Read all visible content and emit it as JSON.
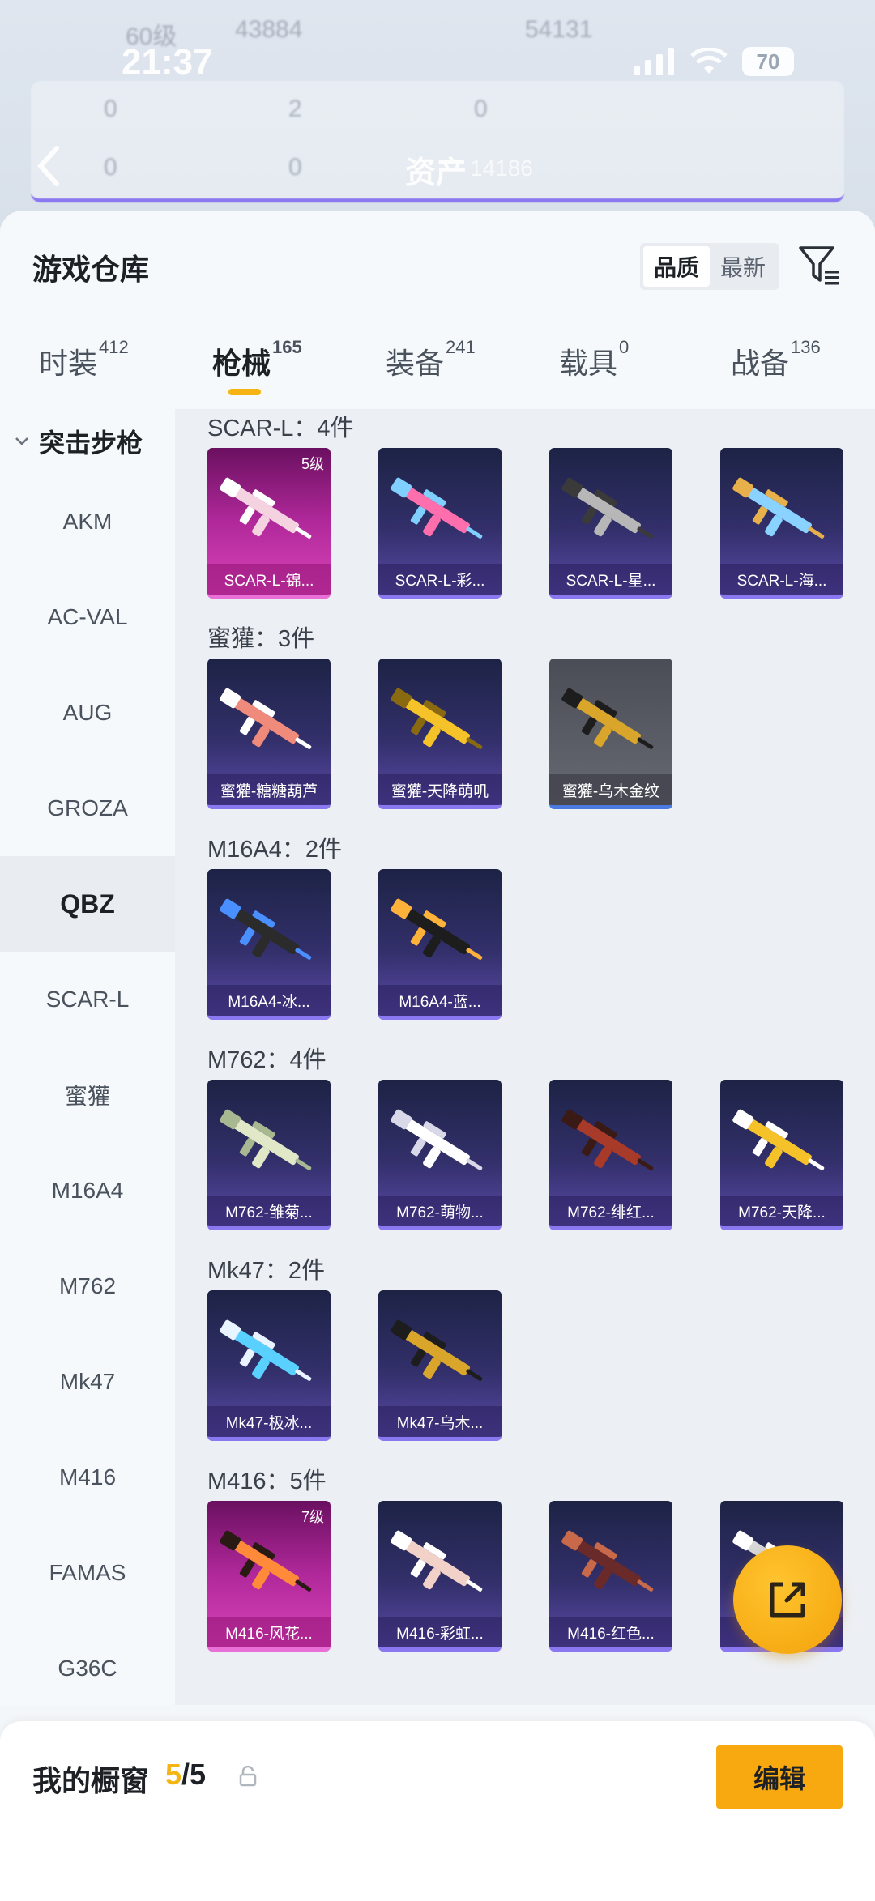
{
  "status_bar": {
    "time": "21:37",
    "battery": "70"
  },
  "background_header": {
    "level_text": "60级",
    "coins_left": "43884",
    "coins_right": "54131",
    "assets_label": "资产",
    "assets_value": "14186",
    "stat_values": [
      "0",
      "2",
      "0",
      "0",
      "0"
    ]
  },
  "warehouse": {
    "title": "游戏仓库",
    "sort_options": [
      "品质",
      "最新"
    ],
    "active_sort": "品质"
  },
  "tabs": [
    {
      "label": "时装",
      "count": "412"
    },
    {
      "label": "枪械",
      "count": "165",
      "active": true
    },
    {
      "label": "装备",
      "count": "241"
    },
    {
      "label": "载具",
      "count": "0"
    },
    {
      "label": "战备",
      "count": "136"
    }
  ],
  "categories": {
    "group": "突击步枪",
    "items": [
      "AKM",
      "AC-VAL",
      "AUG",
      "GROZA",
      "QBZ",
      "SCAR-L",
      "蜜獾",
      "M16A4",
      "M762",
      "Mk47",
      "M416",
      "FAMAS",
      "G36C"
    ],
    "active": "QBZ"
  },
  "sections": [
    {
      "title": "SCAR-L：4件",
      "items": [
        {
          "name": "SCAR-L-锦...",
          "level": "5级",
          "style": "pink"
        },
        {
          "name": "SCAR-L-彩..."
        },
        {
          "name": "SCAR-L-星..."
        },
        {
          "name": "SCAR-L-海..."
        }
      ]
    },
    {
      "title": "蜜獾：3件",
      "items": [
        {
          "name": "蜜獾-糖糖葫芦"
        },
        {
          "name": "蜜獾-天降萌叽"
        },
        {
          "name": "蜜獾-乌木金纹",
          "style": "gray"
        }
      ]
    },
    {
      "title": "M16A4：2件",
      "items": [
        {
          "name": "M16A4-冰..."
        },
        {
          "name": "M16A4-蓝..."
        }
      ]
    },
    {
      "title": "M762：4件",
      "items": [
        {
          "name": "M762-雏菊..."
        },
        {
          "name": "M762-萌物..."
        },
        {
          "name": "M762-绯红..."
        },
        {
          "name": "M762-天降..."
        }
      ]
    },
    {
      "title": "Mk47：2件",
      "items": [
        {
          "name": "Mk47-极冰..."
        },
        {
          "name": "Mk47-乌木..."
        }
      ]
    },
    {
      "title": "M416：5件",
      "items": [
        {
          "name": "M416-风花...",
          "level": "7级",
          "style": "pink"
        },
        {
          "name": "M416-彩虹..."
        },
        {
          "name": "M416-红色..."
        },
        {
          "name": "M416-..."
        }
      ]
    }
  ],
  "showcase": {
    "label": "我的橱窗",
    "current": "5",
    "total": "5",
    "edit_label": "编辑"
  },
  "colors": {
    "accent": "#f5b412",
    "button": "#f7a90f",
    "card_purple": "#322f6a",
    "card_pink": "#b0289a"
  }
}
